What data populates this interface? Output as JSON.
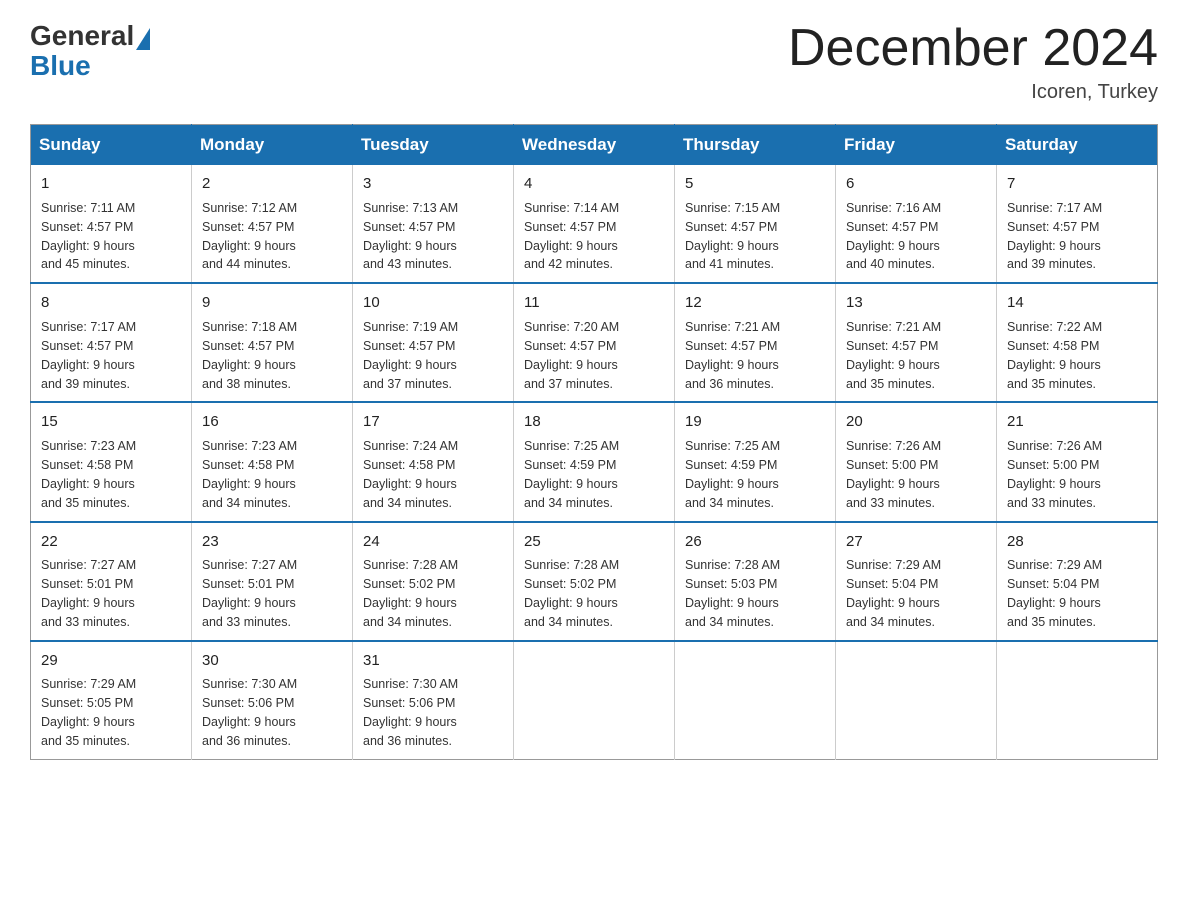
{
  "logo": {
    "general": "General",
    "blue": "Blue"
  },
  "title": "December 2024",
  "location": "Icoren, Turkey",
  "days_of_week": [
    "Sunday",
    "Monday",
    "Tuesday",
    "Wednesday",
    "Thursday",
    "Friday",
    "Saturday"
  ],
  "weeks": [
    [
      {
        "day": "1",
        "sunrise": "7:11 AM",
        "sunset": "4:57 PM",
        "daylight": "9 hours and 45 minutes."
      },
      {
        "day": "2",
        "sunrise": "7:12 AM",
        "sunset": "4:57 PM",
        "daylight": "9 hours and 44 minutes."
      },
      {
        "day": "3",
        "sunrise": "7:13 AM",
        "sunset": "4:57 PM",
        "daylight": "9 hours and 43 minutes."
      },
      {
        "day": "4",
        "sunrise": "7:14 AM",
        "sunset": "4:57 PM",
        "daylight": "9 hours and 42 minutes."
      },
      {
        "day": "5",
        "sunrise": "7:15 AM",
        "sunset": "4:57 PM",
        "daylight": "9 hours and 41 minutes."
      },
      {
        "day": "6",
        "sunrise": "7:16 AM",
        "sunset": "4:57 PM",
        "daylight": "9 hours and 40 minutes."
      },
      {
        "day": "7",
        "sunrise": "7:17 AM",
        "sunset": "4:57 PM",
        "daylight": "9 hours and 39 minutes."
      }
    ],
    [
      {
        "day": "8",
        "sunrise": "7:17 AM",
        "sunset": "4:57 PM",
        "daylight": "9 hours and 39 minutes."
      },
      {
        "day": "9",
        "sunrise": "7:18 AM",
        "sunset": "4:57 PM",
        "daylight": "9 hours and 38 minutes."
      },
      {
        "day": "10",
        "sunrise": "7:19 AM",
        "sunset": "4:57 PM",
        "daylight": "9 hours and 37 minutes."
      },
      {
        "day": "11",
        "sunrise": "7:20 AM",
        "sunset": "4:57 PM",
        "daylight": "9 hours and 37 minutes."
      },
      {
        "day": "12",
        "sunrise": "7:21 AM",
        "sunset": "4:57 PM",
        "daylight": "9 hours and 36 minutes."
      },
      {
        "day": "13",
        "sunrise": "7:21 AM",
        "sunset": "4:57 PM",
        "daylight": "9 hours and 35 minutes."
      },
      {
        "day": "14",
        "sunrise": "7:22 AM",
        "sunset": "4:58 PM",
        "daylight": "9 hours and 35 minutes."
      }
    ],
    [
      {
        "day": "15",
        "sunrise": "7:23 AM",
        "sunset": "4:58 PM",
        "daylight": "9 hours and 35 minutes."
      },
      {
        "day": "16",
        "sunrise": "7:23 AM",
        "sunset": "4:58 PM",
        "daylight": "9 hours and 34 minutes."
      },
      {
        "day": "17",
        "sunrise": "7:24 AM",
        "sunset": "4:58 PM",
        "daylight": "9 hours and 34 minutes."
      },
      {
        "day": "18",
        "sunrise": "7:25 AM",
        "sunset": "4:59 PM",
        "daylight": "9 hours and 34 minutes."
      },
      {
        "day": "19",
        "sunrise": "7:25 AM",
        "sunset": "4:59 PM",
        "daylight": "9 hours and 34 minutes."
      },
      {
        "day": "20",
        "sunrise": "7:26 AM",
        "sunset": "5:00 PM",
        "daylight": "9 hours and 33 minutes."
      },
      {
        "day": "21",
        "sunrise": "7:26 AM",
        "sunset": "5:00 PM",
        "daylight": "9 hours and 33 minutes."
      }
    ],
    [
      {
        "day": "22",
        "sunrise": "7:27 AM",
        "sunset": "5:01 PM",
        "daylight": "9 hours and 33 minutes."
      },
      {
        "day": "23",
        "sunrise": "7:27 AM",
        "sunset": "5:01 PM",
        "daylight": "9 hours and 33 minutes."
      },
      {
        "day": "24",
        "sunrise": "7:28 AM",
        "sunset": "5:02 PM",
        "daylight": "9 hours and 34 minutes."
      },
      {
        "day": "25",
        "sunrise": "7:28 AM",
        "sunset": "5:02 PM",
        "daylight": "9 hours and 34 minutes."
      },
      {
        "day": "26",
        "sunrise": "7:28 AM",
        "sunset": "5:03 PM",
        "daylight": "9 hours and 34 minutes."
      },
      {
        "day": "27",
        "sunrise": "7:29 AM",
        "sunset": "5:04 PM",
        "daylight": "9 hours and 34 minutes."
      },
      {
        "day": "28",
        "sunrise": "7:29 AM",
        "sunset": "5:04 PM",
        "daylight": "9 hours and 35 minutes."
      }
    ],
    [
      {
        "day": "29",
        "sunrise": "7:29 AM",
        "sunset": "5:05 PM",
        "daylight": "9 hours and 35 minutes."
      },
      {
        "day": "30",
        "sunrise": "7:30 AM",
        "sunset": "5:06 PM",
        "daylight": "9 hours and 36 minutes."
      },
      {
        "day": "31",
        "sunrise": "7:30 AM",
        "sunset": "5:06 PM",
        "daylight": "9 hours and 36 minutes."
      },
      null,
      null,
      null,
      null
    ]
  ],
  "labels": {
    "sunrise": "Sunrise:",
    "sunset": "Sunset:",
    "daylight": "Daylight:"
  }
}
